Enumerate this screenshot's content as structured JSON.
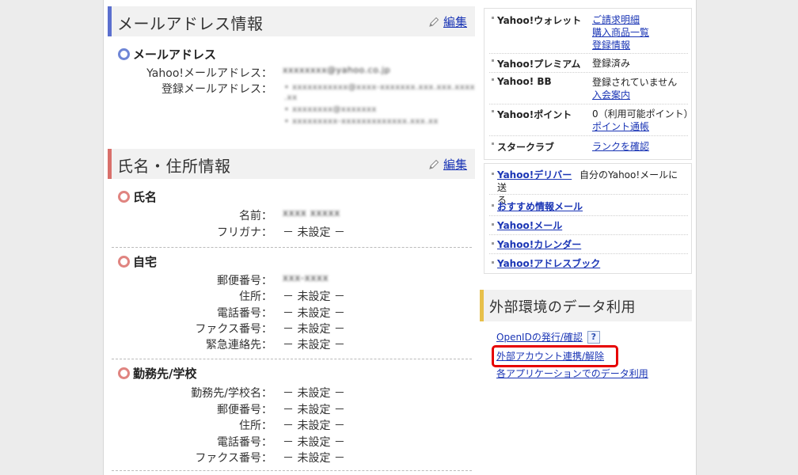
{
  "mail": {
    "title": "メールアドレス情報",
    "edit_label": "編集",
    "group_title": "メールアドレス",
    "yahoo_label": "Yahoo!メールアドレス：",
    "yahoo_value": "xxxxxxxx@yahoo.co.jp",
    "registered_label": "登録メールアドレス：",
    "registered_values": [
      "• xxxxxxxxxxx@xxxx-xxxxxxx.xxx.xxx.xxxx",
      "  .xx",
      "• xxxxxxxx@xxxxxxx",
      "• xxxxxxxxx-xxxxxxxxxxxxx.xxx.xx"
    ]
  },
  "profile": {
    "title": "氏名・住所情報",
    "edit_label": "編集",
    "name_group": "氏名",
    "name_label": "名前：",
    "name_value": "xxxx xxxxx",
    "kana_label": "フリガナ：",
    "kana_value": "－ 未設定 －",
    "home_group": "自宅",
    "home_rows": [
      {
        "label": "郵便番号：",
        "value": "xxx-xxxx"
      },
      {
        "label": "住所：",
        "value": "－ 未設定 －"
      },
      {
        "label": "電話番号：",
        "value": "－ 未設定 －"
      },
      {
        "label": "ファクス番号：",
        "value": "－ 未設定 －"
      },
      {
        "label": "緊急連絡先：",
        "value": "－ 未設定 －"
      }
    ],
    "work_group": "勤務先/学校",
    "work_rows": [
      {
        "label": "勤務先/学校名：",
        "value": "－ 未設定 －"
      },
      {
        "label": "郵便番号：",
        "value": "－ 未設定 －"
      },
      {
        "label": "住所：",
        "value": "－ 未設定 －"
      },
      {
        "label": "電話番号：",
        "value": "－ 未設定 －"
      },
      {
        "label": "ファクス番号：",
        "value": "－ 未設定 －"
      }
    ]
  },
  "services": {
    "wallet": {
      "name": "Yahoo!ウォレット",
      "links": [
        "ご請求明細",
        "購入商品一覧",
        "登録情報"
      ]
    },
    "premium": {
      "name": "Yahoo!プレミアム",
      "status": "登録済み"
    },
    "bb": {
      "name": "Yahoo! BB",
      "status": "登録されていません",
      "link": "入会案内"
    },
    "points": {
      "name": "Yahoo!ポイント",
      "status": "0（利用可能ポイント）",
      "link": "ポイント通帳"
    },
    "starclub": {
      "name": "スタークラブ",
      "link": "ランクを確認"
    }
  },
  "quick_links": {
    "delivery": "Yahoo!デリバー",
    "delivery_desc_1": "自分のYahoo!メールに送",
    "delivery_desc_2": "る",
    "recommend": "おすすめ情報メール",
    "mail": "Yahoo!メール",
    "calendar": "Yahoo!カレンダー",
    "addressbook": "Yahoo!アドレスブック"
  },
  "external": {
    "title": "外部環境のデータ利用",
    "openid": "OpenIDの発行/確認",
    "help": "?",
    "account_link": "外部アカウント連携/解除",
    "apps": "各アプリケーションでのデータ利用"
  },
  "colors": {
    "mail_bar": "#5b6fcf",
    "profile_bar": "#d9706b",
    "external_bar": "#e7c04a",
    "link": "#1a35b5",
    "highlight": "#e60000"
  }
}
